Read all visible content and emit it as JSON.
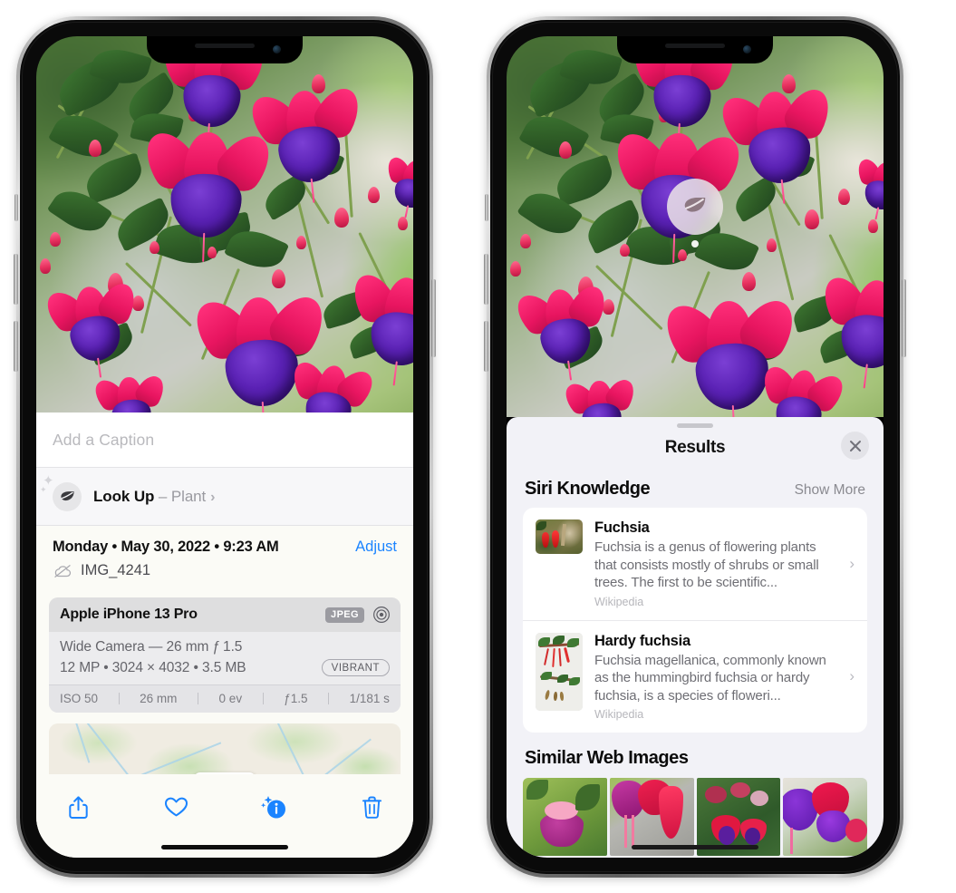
{
  "page": {
    "title": "iPhone Photos app — Visual Look Up for plants (two screenshots)"
  },
  "left_phone": {
    "name": "iPhone 13 Pro — Photos detail view",
    "caption_field": {
      "placeholder": "Add a Caption",
      "value": ""
    },
    "look_up": {
      "icon": "leaf-icon",
      "sparkle_icon": "sparkle-icon",
      "label": "Look Up",
      "dash": " – ",
      "subject": "Plant",
      "chevron": "›"
    },
    "meta": {
      "date": "Monday • May 30, 2022 • 9:23 AM",
      "adjust_label": "Adjust",
      "cloud_icon": "cloud-slash-icon",
      "filename": "IMG_4241"
    },
    "camera_card": {
      "device": "Apple iPhone 13 Pro",
      "format_tag": "JPEG",
      "aperture_icon": "aperture-icon",
      "lens_line": "Wide Camera — 26 mm ƒ 1.5",
      "size_line": "12 MP • 3024 × 4032 • 3.5 MB",
      "style_pill": "VIBRANT",
      "exif": [
        "ISO 50",
        "26 mm",
        "0 ev",
        "ƒ1.5",
        "1/181 s"
      ]
    },
    "map": {
      "alt": "map-strip-with-photo-pin"
    },
    "toolbar": [
      {
        "name": "share-icon",
        "label": "Share"
      },
      {
        "name": "heart-icon",
        "label": "Favorite"
      },
      {
        "name": "info-sparkle-icon",
        "label": "Info"
      },
      {
        "name": "trash-icon",
        "label": "Delete"
      }
    ]
  },
  "right_phone": {
    "name": "iPhone 13 Pro — Visual Look Up Results sheet",
    "badge": {
      "icon": "leaf-icon",
      "label": "Plant identification badge"
    },
    "sheet": {
      "grabber": "sheet-grabber",
      "title": "Results",
      "close_icon": "close-icon"
    },
    "siri_knowledge": {
      "heading": "Siri Knowledge",
      "show_more": "Show More",
      "items": [
        {
          "title": "Fuchsia",
          "description": "Fuchsia is a genus of flowering plants that consists mostly of shrubs or small trees. The first to be scientific...",
          "source": "Wikipedia",
          "thumb": "fuchsia-red-flowers-thumb",
          "chevron": "›"
        },
        {
          "title": "Hardy fuchsia",
          "description": "Fuchsia magellanica, commonly known as the hummingbird fuchsia or hardy fuchsia, is a species of floweri...",
          "source": "Wikipedia",
          "thumb": "hardy-fuchsia-herbarium-thumb",
          "chevron": "›"
        }
      ]
    },
    "similar_web_images": {
      "heading": "Similar Web Images",
      "items": [
        {
          "alt": "magenta-fuchsia-on-green-leaves"
        },
        {
          "alt": "crimson-fuchsia-closeup"
        },
        {
          "alt": "red-purple-fuchsia-bush"
        },
        {
          "alt": "purple-and-red-fuchsia-cluster"
        }
      ]
    }
  },
  "colors": {
    "accent_blue": "#1b84ff",
    "sheet_bg": "#f2f2f7",
    "card_bg": "#ffffff",
    "secondary_text": "#8a8a90",
    "detail_bg": "#fbfbf6"
  }
}
